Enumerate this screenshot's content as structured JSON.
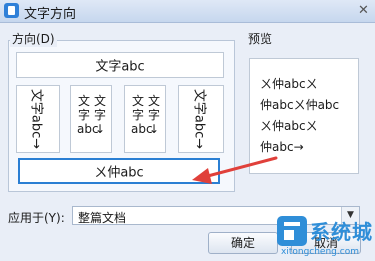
{
  "window": {
    "title": "文字方向",
    "close_glyph": "✕"
  },
  "direction_group": {
    "label": "方向(D)",
    "options": [
      {
        "id": "horizontal",
        "text": "文字abc"
      },
      {
        "id": "vertical-rotated-right",
        "text": "文字abc→"
      },
      {
        "id": "vertical-stacked-1",
        "col1": "文字abc",
        "col2": "文字↓"
      },
      {
        "id": "vertical-stacked-2",
        "col1": "文字abc",
        "col2": "文字↓"
      },
      {
        "id": "vertical-rotated-right-2",
        "text": "文字abc→"
      },
      {
        "id": "horizontal-rotated-glyphs",
        "text": "ㄨ仲abc"
      }
    ],
    "selected": "horizontal-rotated-glyphs"
  },
  "preview": {
    "label": "预览",
    "lines": [
      "ㄨ仲abcㄨ",
      "仲abcㄨ仲abc",
      "ㄨ仲abcㄨ",
      "仲abc→"
    ]
  },
  "apply_to": {
    "label": "应用于(Y):",
    "value": "整篇文档"
  },
  "buttons": {
    "ok": "确定",
    "cancel": "取消"
  },
  "watermark": {
    "text": "系统城",
    "url": "xitongcheng.com"
  },
  "colors": {
    "selection_border": "#2b7fd3",
    "annotation_arrow": "#e0403a",
    "dialog_background": "#e9eef7"
  }
}
